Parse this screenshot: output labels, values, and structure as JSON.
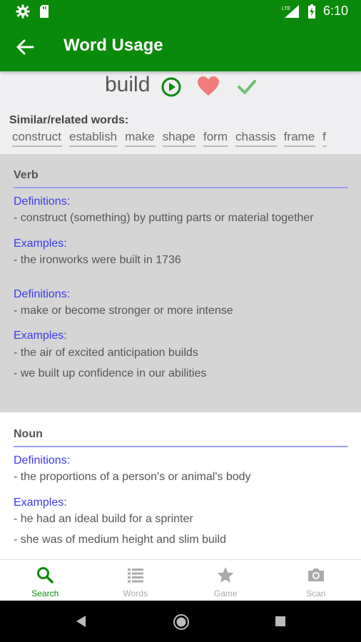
{
  "status_bar": {
    "time": "6:10",
    "network": "LTE"
  },
  "app_bar": {
    "title": "Word Usage"
  },
  "word": "build",
  "similar": {
    "label": "Similar/related words:",
    "words": [
      "construct",
      "establish",
      "make",
      "shape",
      "form",
      "chassis",
      "frame",
      "f"
    ]
  },
  "verb": {
    "title": "Verb",
    "definitions_label_1": "Definitions:",
    "definition_1": "- construct (something) by putting parts or material together",
    "examples_label_1": "Examples:",
    "example_1a": "- the ironworks were built in 1736",
    "definitions_label_2": "Definitions:",
    "definition_2": "- make or become stronger or more intense",
    "examples_label_2": "Examples:",
    "example_2a": "- the air of excited anticipation builds",
    "example_2b": "- we built up confidence in our abilities"
  },
  "noun": {
    "title": "Noun",
    "definitions_label_1": "Definitions:",
    "definition_1": "- the proportions of a person's or animal's body",
    "examples_label_1": "Examples:",
    "example_1a": "- he had an ideal build for a sprinter",
    "example_1b": "- she was of medium height and slim build"
  },
  "bottom_nav": {
    "search": "Search",
    "words": "Words",
    "game": "Game",
    "scan": "Scan"
  },
  "colors": {
    "primary": "#0a8a0a",
    "link": "#3a3af0",
    "heart": "#f27b7b",
    "check": "#6fbf6f"
  }
}
